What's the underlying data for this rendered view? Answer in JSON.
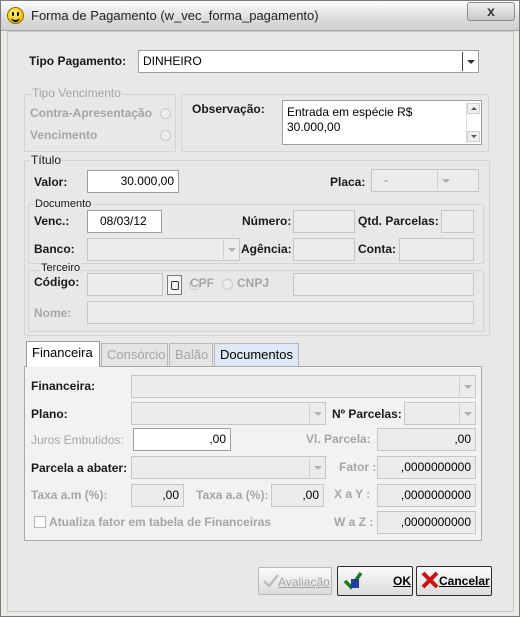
{
  "window": {
    "title": "Forma de Pagamento (w_vec_forma_pagamento)",
    "close_label": "x"
  },
  "tipo_pagamento": {
    "label": "Tipo Pagamento:",
    "value": "DINHEIRO"
  },
  "tipo_vencimento": {
    "group_label": "Tipo Vencimento",
    "options": [
      "Contra-Apresentação",
      "Vencimento"
    ]
  },
  "observacao": {
    "label": "Observação:",
    "line1": "Entrada em espécie R$",
    "line2": "30.000,00"
  },
  "titulo": {
    "group_label": "Título",
    "valor_label": "Valor:",
    "valor": "30.000,00",
    "placa_label": "Placa:",
    "placa_value": "-"
  },
  "documento": {
    "group_label": "Documento",
    "venc_label": "Venc.:",
    "venc_value": "08/03/12",
    "numero_label": "Número:",
    "qtd_parcelas_label": "Qtd. Parcelas:",
    "banco_label": "Banco:",
    "agencia_label": "Agência:",
    "conta_label": "Conta:"
  },
  "terceiro": {
    "group_label": "Terceiro",
    "codigo_label": "Código:",
    "cpf_label": "CPF",
    "cnpj_label": "CNPJ",
    "nome_label": "Nome:"
  },
  "tabs": [
    "Financeira",
    "Consórcio",
    "Balão",
    "Documentos"
  ],
  "financeira": {
    "financeira_label": "Financeira:",
    "plano_label": "Plano:",
    "n_parcelas_label": "Nº Parcelas:",
    "juros_label": "Juros Embutidos:",
    "juros_value": ",00",
    "vl_parcela_label": "Vl. Parcela:",
    "vl_parcela_value": ",00",
    "parcela_abater_label": "Parcela a abater:",
    "fator_label": "Fator :",
    "fator_value": ",0000000000",
    "taxa_am_label": "Taxa a.m (%):",
    "taxa_am_value": ",00",
    "taxa_aa_label": "Taxa a.a (%):",
    "taxa_aa_value": ",00",
    "xay_label": "X a Y :",
    "xay_value": ",0000000000",
    "atualiza_label": "Atualiza fator em tabela de Financeiras",
    "waz_label": "W a Z :",
    "waz_value": ",0000000000"
  },
  "buttons": {
    "avaliacao": "Avaliação",
    "ok": "OK",
    "cancelar": "Cancelar"
  },
  "icons": {
    "window": "smiley-icon",
    "ok": "check-icon",
    "cancel": "x-icon",
    "avaliacao": "check-icon"
  }
}
